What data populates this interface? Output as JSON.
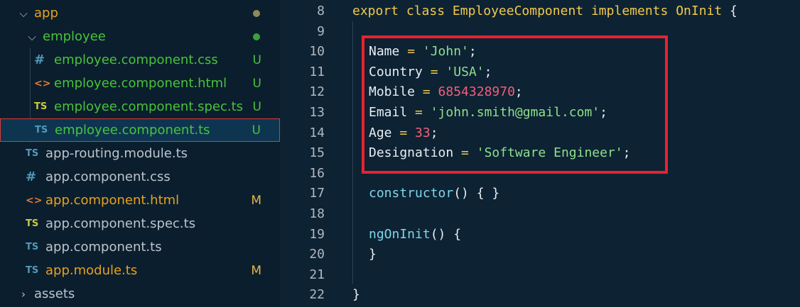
{
  "explorer": {
    "items": [
      {
        "name": "app",
        "kind": "folder",
        "state": "open",
        "color": "orange",
        "status_dot": "#8f8a5a"
      },
      {
        "name": "employee",
        "kind": "folder",
        "state": "open",
        "color": "green",
        "status_dot": "#3ba13b"
      },
      {
        "name": "employee.component.css",
        "icon": "#",
        "icon_kind": "css",
        "color": "green",
        "badge": "U"
      },
      {
        "name": "employee.component.html",
        "icon": "<>",
        "icon_kind": "html",
        "color": "green",
        "badge": "U"
      },
      {
        "name": "employee.component.spec.ts",
        "icon": "TS",
        "icon_kind": "spec",
        "color": "green",
        "badge": "U"
      },
      {
        "name": "employee.component.ts",
        "icon": "TS",
        "icon_kind": "ts",
        "color": "green",
        "badge": "U",
        "selected": true
      },
      {
        "name": "app-routing.module.ts",
        "icon": "TS",
        "icon_kind": "ts",
        "color": "default"
      },
      {
        "name": "app.component.css",
        "icon": "#",
        "icon_kind": "css",
        "color": "default"
      },
      {
        "name": "app.component.html",
        "icon": "<>",
        "icon_kind": "html",
        "color": "orange",
        "badge": "M"
      },
      {
        "name": "app.component.spec.ts",
        "icon": "TS",
        "icon_kind": "spec",
        "color": "default"
      },
      {
        "name": "app.component.ts",
        "icon": "TS",
        "icon_kind": "ts",
        "color": "default"
      },
      {
        "name": "app.module.ts",
        "icon": "TS",
        "icon_kind": "ts",
        "color": "orange",
        "badge": "M"
      },
      {
        "name": "assets",
        "kind": "folder",
        "state": "closed",
        "color": "default"
      }
    ]
  },
  "editor": {
    "lines": [
      {
        "n": "8",
        "tokens": [
          [
            "kw",
            "export "
          ],
          [
            "kw",
            "class "
          ],
          [
            "cls",
            "EmployeeComponent "
          ],
          [
            "kw",
            "implements "
          ],
          [
            "cls",
            "OnInit "
          ],
          [
            "pun",
            "{"
          ]
        ]
      },
      {
        "n": "9",
        "tokens": []
      },
      {
        "n": "10",
        "tokens": [
          [
            "id",
            "Name "
          ],
          [
            "op",
            "= "
          ],
          [
            "str",
            "'John'"
          ],
          [
            "pun",
            ";"
          ]
        ]
      },
      {
        "n": "11",
        "tokens": [
          [
            "id",
            "Country "
          ],
          [
            "op",
            "= "
          ],
          [
            "str",
            "'USA'"
          ],
          [
            "pun",
            ";"
          ]
        ]
      },
      {
        "n": "12",
        "tokens": [
          [
            "id",
            "Mobile "
          ],
          [
            "op",
            "= "
          ],
          [
            "num",
            "6854328970"
          ],
          [
            "pun",
            ";"
          ]
        ]
      },
      {
        "n": "13",
        "tokens": [
          [
            "id",
            "Email "
          ],
          [
            "op",
            "= "
          ],
          [
            "str",
            "'john.smith@gmail.com'"
          ],
          [
            "pun",
            ";"
          ]
        ]
      },
      {
        "n": "14",
        "tokens": [
          [
            "id",
            "Age "
          ],
          [
            "op",
            "= "
          ],
          [
            "num",
            "33"
          ],
          [
            "pun",
            ";"
          ]
        ]
      },
      {
        "n": "15",
        "tokens": [
          [
            "id",
            "Designation "
          ],
          [
            "op",
            "= "
          ],
          [
            "str",
            "'Software Engineer'"
          ],
          [
            "pun",
            ";"
          ]
        ]
      },
      {
        "n": "16",
        "tokens": []
      },
      {
        "n": "17",
        "tokens": [
          [
            "fn",
            "constructor"
          ],
          [
            "pun",
            "() { }"
          ]
        ]
      },
      {
        "n": "18",
        "tokens": []
      },
      {
        "n": "19",
        "tokens": [
          [
            "fn",
            "ngOnInit"
          ],
          [
            "pun",
            "() {"
          ]
        ]
      },
      {
        "n": "20",
        "tokens": [
          [
            "pun",
            "}"
          ]
        ]
      },
      {
        "n": "21",
        "tokens": []
      },
      {
        "n": "22",
        "tokens": [
          [
            "pun",
            "}"
          ]
        ]
      }
    ]
  }
}
